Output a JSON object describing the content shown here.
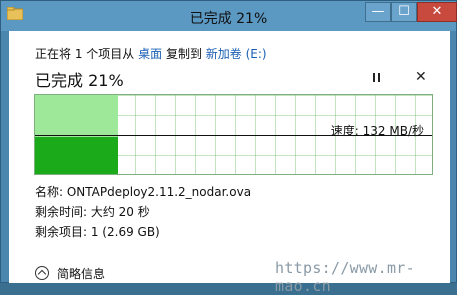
{
  "window": {
    "title": "已完成 21%",
    "icons": {
      "app": "folder-icon",
      "minimize": "minimize-icon",
      "maximize": "maximize-icon",
      "close": "close-icon"
    },
    "glyphs": {
      "minimize": "—",
      "maximize": "☐",
      "close": "✕"
    }
  },
  "copy": {
    "prefix": "正在将 1 个项目从",
    "source": "桌面",
    "middle": "复制到",
    "destination": "新加卷 (E:)",
    "percent_label": "已完成 21%",
    "progress": 0.21,
    "speed_label": "速度: 132 MB/秒",
    "pause_icon": "pause-icon",
    "stop_icon": "stop-icon",
    "stop_glyph": "✕"
  },
  "details": {
    "name": "名称: ONTAPdeploy2.11.2_nodar.ova",
    "time_remaining": "剩余时间: 大约 20 秒",
    "items_remaining": "剩余项目: 1 (2.69 GB)",
    "toggle_label": "简略信息"
  },
  "watermark": "https://www.mr-mao.cn",
  "colors": {
    "titlebar": "#5b98c2",
    "progress_light": "#9ee89a",
    "progress_dark": "#1aaa1a",
    "close_button": "#c84a3f",
    "link": "#1a5fb4"
  }
}
